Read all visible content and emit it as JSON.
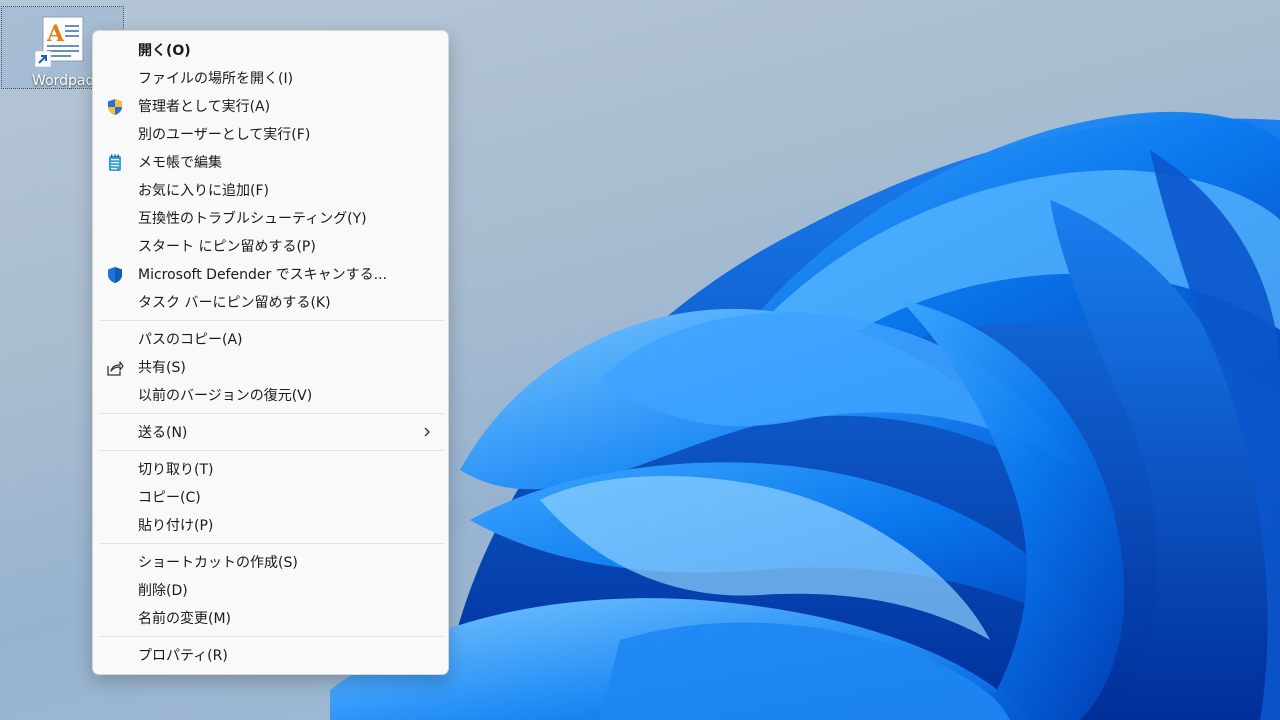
{
  "desktop": {
    "icon": {
      "label": "Wordpad",
      "name": "wordpad-shortcut"
    }
  },
  "menu": {
    "open": "開く(O)",
    "open_location": "ファイルの場所を開く(I)",
    "run_as_admin": "管理者として実行(A)",
    "run_as_other": "別のユーザーとして実行(F)",
    "edit_notepad": "メモ帳で編集",
    "add_favorites": "お気に入りに追加(F)",
    "troubleshoot": "互換性のトラブルシューティング(Y)",
    "pin_start": "スタート にピン留めする(P)",
    "defender": "Microsoft Defender でスキャンする...",
    "pin_taskbar": "タスク バーにピン留めする(K)",
    "copy_path": "パスのコピー(A)",
    "share": "共有(S)",
    "restore": "以前のバージョンの復元(V)",
    "send_to": "送る(N)",
    "cut": "切り取り(T)",
    "copy": "コピー(C)",
    "paste": "貼り付け(P)",
    "create_shortcut": "ショートカットの作成(S)",
    "delete": "削除(D)",
    "rename": "名前の変更(M)",
    "properties": "プロパティ(R)"
  },
  "icons": {
    "run_as_admin": "uac-shield-icon",
    "edit_notepad": "notepad-icon",
    "defender": "defender-shield-icon",
    "share": "share-icon",
    "send_to": "chevron-right-icon"
  }
}
